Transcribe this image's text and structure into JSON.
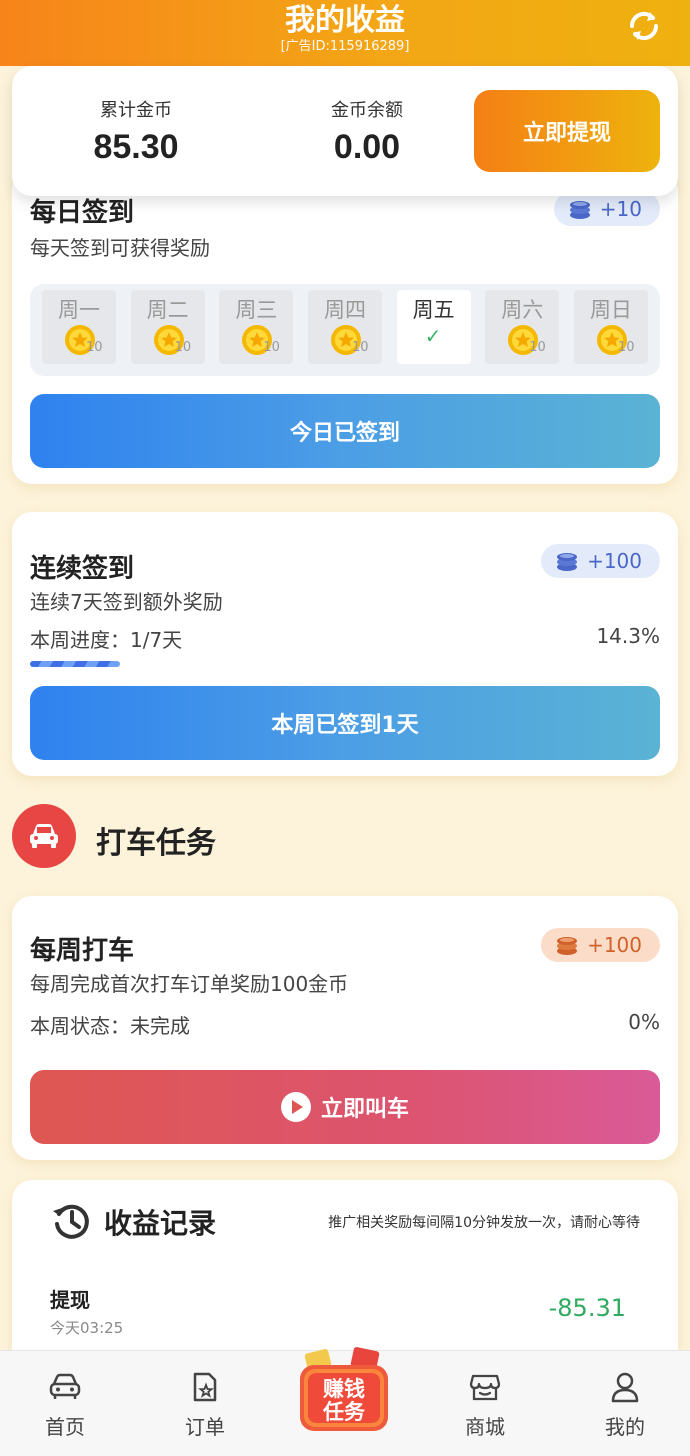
{
  "header": {
    "title": "我的收益",
    "ad_id": "[广告ID:115916289]"
  },
  "balance": {
    "total_label": "累计金币",
    "total_value": "85.30",
    "remain_label": "金币余额",
    "remain_value": "0.00",
    "withdraw_label": "立即提现"
  },
  "daily_sign": {
    "title": "每日签到",
    "subtitle": "每天签到可获得奖励",
    "reward": "+10",
    "days": [
      {
        "name": "周一",
        "reward": "10",
        "checked": false
      },
      {
        "name": "周二",
        "reward": "10",
        "checked": false
      },
      {
        "name": "周三",
        "reward": "10",
        "checked": false
      },
      {
        "name": "周四",
        "reward": "10",
        "checked": false
      },
      {
        "name": "周五",
        "reward": "",
        "checked": true
      },
      {
        "name": "周六",
        "reward": "10",
        "checked": false
      },
      {
        "name": "周日",
        "reward": "10",
        "checked": false
      }
    ],
    "button_label": "今日已签到"
  },
  "continuous_sign": {
    "title": "连续签到",
    "subtitle": "连续7天签到额外奖励",
    "reward": "+100",
    "progress_label": "本周进度：1/7天",
    "progress_percent_text": "14.3%",
    "progress_fraction": 0.143,
    "button_label": "本周已签到1天"
  },
  "taxi_section": {
    "title": "打车任务"
  },
  "weekly_taxi": {
    "title": "每周打车",
    "subtitle": "每周完成首次打车订单奖励100金币",
    "reward": "+100",
    "status_label": "本周状态：未完成",
    "status_percent": "0%",
    "button_label": "立即叫车"
  },
  "records": {
    "title": "收益记录",
    "note": "推广相关奖励每间隔10分钟发放一次，请耐心等待",
    "items": [
      {
        "name": "提现",
        "time": "今天03:25",
        "amount": "-85.31"
      }
    ]
  },
  "bottom_nav": {
    "items": [
      {
        "label": "首页"
      },
      {
        "label": "订单"
      },
      {
        "label": "赚钱任务"
      },
      {
        "label": "商城"
      },
      {
        "label": "我的"
      }
    ]
  },
  "colors": {
    "header_start": "#f7841a",
    "header_end": "#efb10f",
    "blue_button": "#2f82ef",
    "red_button": "#df5752",
    "negative_amount": "#2faa5e",
    "page_bg": "#fdf3da"
  }
}
